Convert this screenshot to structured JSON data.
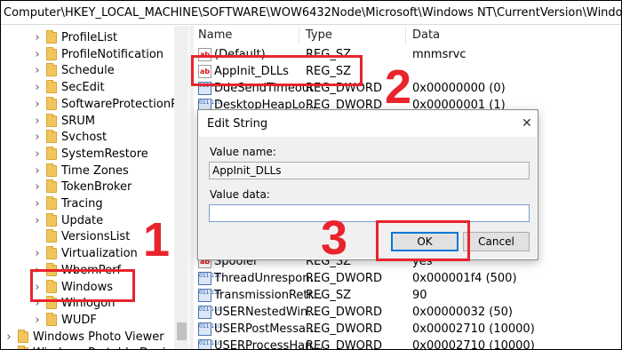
{
  "address_bar": {
    "path": "Computer\\HKEY_LOCAL_MACHINE\\SOFTWARE\\WOW6432Node\\Microsoft\\Windows NT\\CurrentVersion\\Windows"
  },
  "tree": {
    "items": [
      {
        "label": "ProfileList",
        "expandable": true
      },
      {
        "label": "ProfileNotification",
        "expandable": true
      },
      {
        "label": "Schedule",
        "expandable": true
      },
      {
        "label": "SecEdit",
        "expandable": true
      },
      {
        "label": "SoftwareProtectionPlatf",
        "expandable": true
      },
      {
        "label": "SRUM",
        "expandable": true
      },
      {
        "label": "Svchost",
        "expandable": true
      },
      {
        "label": "SystemRestore",
        "expandable": true
      },
      {
        "label": "Time Zones",
        "expandable": true
      },
      {
        "label": "TokenBroker",
        "expandable": true
      },
      {
        "label": "Tracing",
        "expandable": true
      },
      {
        "label": "Update",
        "expandable": true
      },
      {
        "label": "VersionsList",
        "expandable": false
      },
      {
        "label": "Virtualization",
        "expandable": true
      },
      {
        "label": "WbemPerf",
        "expandable": true
      },
      {
        "label": "Windows",
        "expandable": true,
        "selected": true
      },
      {
        "label": "Winlogon",
        "expandable": true
      },
      {
        "label": "WUDF",
        "expandable": true
      },
      {
        "label": "Windows Photo Viewer",
        "expandable": true
      },
      {
        "label": "Windows Portable Devices",
        "expandable": true
      }
    ]
  },
  "list": {
    "columns": {
      "name": "Name",
      "type": "Type",
      "data": "Data"
    },
    "rows": [
      {
        "icon": "string-value-icon",
        "name": "(Default)",
        "type": "REG_SZ",
        "data": "mnmsrvc"
      },
      {
        "icon": "string-value-icon",
        "name": "AppInit_DLLs",
        "type": "REG_SZ",
        "data": ""
      },
      {
        "icon": "binary-value-icon",
        "name": "DdeSendTimeout",
        "type": "REG_DWORD",
        "data": "0x00000000 (0)"
      },
      {
        "icon": "binary-value-icon",
        "name": "DesktopHeapLo...",
        "type": "REG_DWORD",
        "data": "0x00000001 (1)"
      },
      {
        "icon": "string-value-icon",
        "name": "Spooler",
        "type": "REG_SZ",
        "data": "yes"
      },
      {
        "icon": "binary-value-icon",
        "name": "ThreadUnrespon...",
        "type": "REG_DWORD",
        "data": "0x000001f4 (500)"
      },
      {
        "icon": "binary-value-icon",
        "name": "TransmissionRetr...",
        "type": "REG_SZ",
        "data": "90"
      },
      {
        "icon": "binary-value-icon",
        "name": "USERNestedWin...",
        "type": "REG_DWORD",
        "data": "0x00000032 (50)"
      },
      {
        "icon": "binary-value-icon",
        "name": "USERPostMessa...",
        "type": "REG_DWORD",
        "data": "0x00002710 (10000)"
      },
      {
        "icon": "binary-value-icon",
        "name": "USERProcessHan...",
        "type": "REG_DWORD",
        "data": "0x00002710 (10000)"
      }
    ]
  },
  "dialog": {
    "title": "Edit String",
    "close_icon": "close-icon",
    "value_name_label": "Value name:",
    "value_name": "AppInit_DLLs",
    "value_data_label": "Value data:",
    "value_data": "",
    "ok_label": "OK",
    "cancel_label": "Cancel"
  },
  "annotations": {
    "step1": "1",
    "step2": "2",
    "step3": "3",
    "highlight_color": "#e8242c"
  }
}
